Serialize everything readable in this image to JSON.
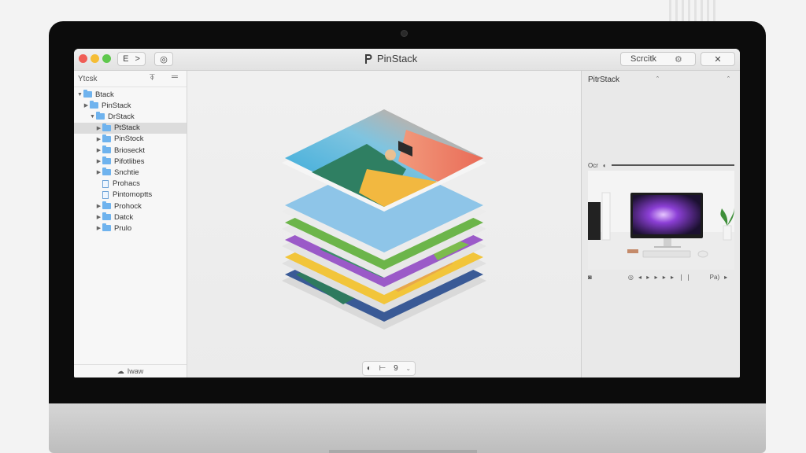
{
  "app": {
    "title": "PinStack",
    "toolbar": {
      "nav_label": "E",
      "forward_label": ">",
      "info_label": "◎",
      "search_label": "Scrcitk",
      "gear_label": "⚙",
      "close_label": "✕"
    }
  },
  "sidebar": {
    "header_label": "Ytcsk",
    "add_icon_label": "⍕",
    "menu_icon_label": "═",
    "items": [
      {
        "label": "Btack",
        "chevron": "▼",
        "kind": "folder",
        "indent": 0
      },
      {
        "label": "PinStack",
        "chevron": "▶",
        "kind": "folder",
        "indent": 1
      },
      {
        "label": "DrStack",
        "chevron": "▼",
        "kind": "folder",
        "indent": 2
      },
      {
        "label": "PtStack",
        "chevron": "▶",
        "kind": "folder",
        "indent": 3,
        "selected": true
      },
      {
        "label": "PinStock",
        "chevron": "▶",
        "kind": "folder",
        "indent": 3
      },
      {
        "label": "Brioseckt",
        "chevron": "▶",
        "kind": "folder",
        "indent": 3
      },
      {
        "label": "Pifotlibes",
        "chevron": "▶",
        "kind": "folder",
        "indent": 3
      },
      {
        "label": "Snchtie",
        "chevron": "▶",
        "kind": "folder",
        "indent": 3
      },
      {
        "label": "Prohacs",
        "chevron": "",
        "kind": "doc",
        "indent": 3
      },
      {
        "label": "Pintomoptts",
        "chevron": "",
        "kind": "doc",
        "indent": 3
      },
      {
        "label": "Prohock",
        "chevron": "▶",
        "kind": "folder",
        "indent": 3
      },
      {
        "label": "Datck",
        "chevron": "▶",
        "kind": "folder",
        "indent": 3
      },
      {
        "label": "Prulo",
        "chevron": "▶",
        "kind": "folder",
        "indent": 3
      }
    ],
    "footer_label": "Iwaw"
  },
  "center": {
    "pager": {
      "left": "◐",
      "mid": "⊢",
      "right": "9",
      "caret": "⌄"
    }
  },
  "right_panel": {
    "header_label": "PitrStack",
    "caret_label": "ˆ",
    "collapse_label": "ˆ",
    "preview_bar_left": "Ocr",
    "controls": {
      "left": "◙",
      "mid": "◎ ◂ ▸ ▸ ▸ ▸ ❘❘",
      "right": "Pa)",
      "arrow": "▸"
    }
  },
  "colors": {
    "folder": "#6fb3ee",
    "selection": "#dcdcdc",
    "traffic_red": "#f05d56",
    "traffic_yellow": "#f5bd35",
    "traffic_green": "#5fc84d"
  }
}
